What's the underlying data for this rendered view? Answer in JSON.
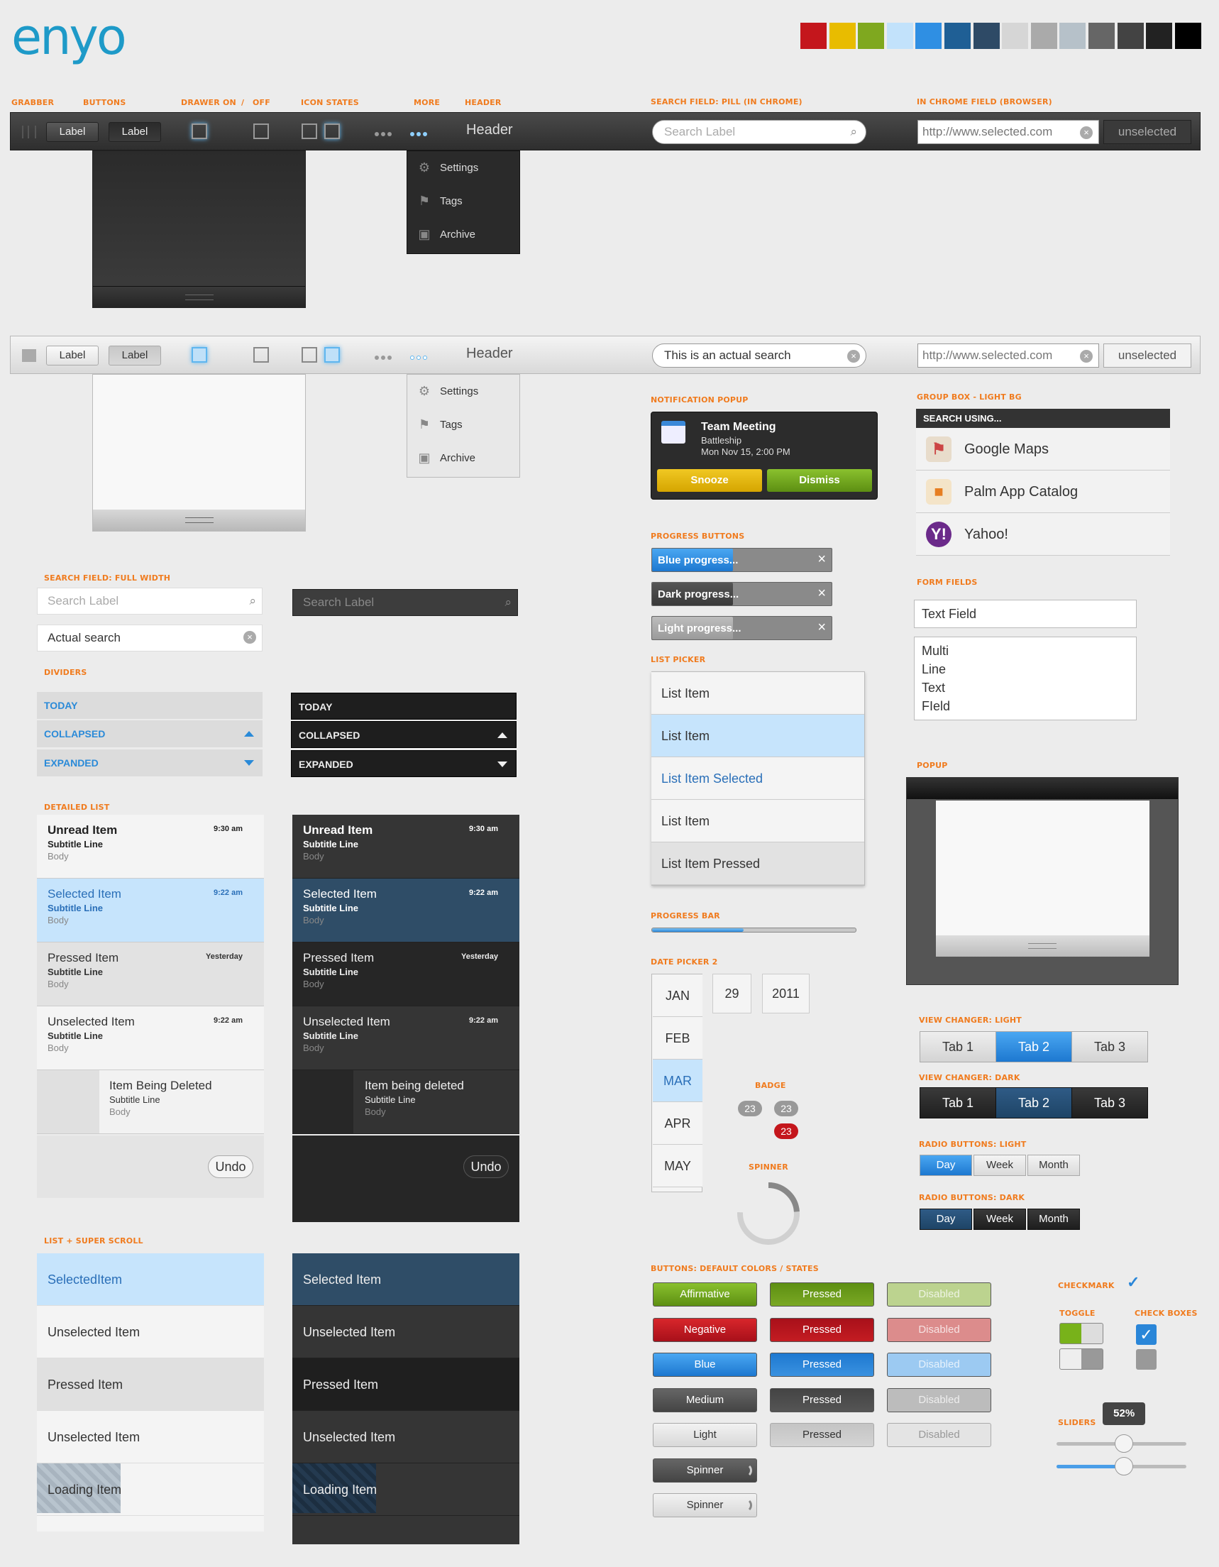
{
  "logo": "enyo",
  "swatches": [
    "#c4161c",
    "#e8bc00",
    "#7fa81f",
    "#c2e2fb",
    "#2f8fe3",
    "#1f5f95",
    "#2e4a66",
    "#d6d6d6",
    "#aaaaaa",
    "#b6c1c9",
    "#666666",
    "#434343",
    "#222222",
    "#000000"
  ],
  "labels": {
    "grabber": "GRABBER",
    "buttons": "BUTTONS",
    "drawer_on": "DRAWER ON",
    "slash": "/",
    "off": "OFF",
    "icon_states": "ICON STATES",
    "more": "MORE",
    "header": "HEADER",
    "search_pill": "SEARCH FIELD: PILL (IN CHROME)",
    "chrome_field": "IN CHROME FIELD (BROWSER)",
    "search_full": "SEARCH FIELD: FULL WIDTH",
    "dividers": "DIVIDERS",
    "detailed_list": "DETAILED LIST",
    "super_scroll": "LIST + SUPER SCROLL",
    "notification": "NOTIFICATION POPUP",
    "progress_buttons": "PROGRESS BUTTONS",
    "list_picker": "LIST PICKER",
    "progress_bar": "PROGRESS BAR",
    "date_picker": "DATE PICKER 2",
    "badge": "BADGE",
    "spinner": "SPINNER",
    "buttons_default": "BUTTONS: DEFAULT COLORS / STATES",
    "group_box": "GROUP BOX - LIGHT BG",
    "form_fields": "FORM FIELDS",
    "popup": "POPUP",
    "view_light": "VIEW CHANGER: LIGHT",
    "view_dark": "VIEW CHANGER: DARK",
    "radio_light": "RADIO BUTTONS: LIGHT",
    "radio_dark": "RADIO BUTTONS: DARK",
    "checkmark": "CHECKMARK",
    "toggle": "TOGGLE",
    "check_boxes": "CHECK BOXES",
    "sliders": "SLIDERS"
  },
  "toolbar": {
    "btn1": "Label",
    "btn2": "Label",
    "header": "Header",
    "search_placeholder": "Search Label",
    "search_value": "This is an actual search",
    "url": "http://www.selected.com",
    "unselected": "unselected"
  },
  "menu": [
    "Settings",
    "Tags",
    "Archive"
  ],
  "search_full": {
    "placeholder": "Search Label",
    "value": "Actual search"
  },
  "dividers": [
    "TODAY",
    "COLLAPSED",
    "EXPANDED"
  ],
  "detailed": [
    {
      "title": "Unread Item",
      "subtitle": "Subtitle Line",
      "body": "Body",
      "time": "9:30 am"
    },
    {
      "title": "Selected Item",
      "subtitle": "Subtitle Line",
      "body": "Body",
      "time": "9:22 am"
    },
    {
      "title": "Pressed Item",
      "subtitle": "Subtitle Line",
      "body": "Body",
      "time": "Yesterday"
    },
    {
      "title": "Unselected Item",
      "subtitle": "Subtitle Line",
      "body": "Body",
      "time": "9:22 am"
    }
  ],
  "deleting": {
    "light_title": "Item Being Deleted",
    "dark_title": "Item being deleted",
    "subtitle": "Subtitle Line",
    "body": "Body",
    "undo": "Undo"
  },
  "super_light": [
    "SelectedItem",
    "Unselected Item",
    "Pressed Item",
    "Unselected Item",
    "Loading Item"
  ],
  "super_dark": [
    "Selected Item",
    "Unselected Item",
    "Pressed Item",
    "Unselected Item",
    "Loading Item"
  ],
  "notification": {
    "title": "Team Meeting",
    "location": "Battleship",
    "time": "Mon Nov 15, 2:00 PM",
    "snooze": "Snooze",
    "dismiss": "Dismiss"
  },
  "progress_buttons": [
    {
      "label": "Blue progress...",
      "progress": 0.45
    },
    {
      "label": "Dark progress...",
      "progress": 0.45
    },
    {
      "label": "Light progress...",
      "progress": 0.45
    }
  ],
  "list_picker": [
    "List Item",
    "List Item",
    "List Item Selected",
    "List Item",
    "List Item Pressed"
  ],
  "progress_bar": 0.45,
  "date": {
    "months": [
      "JAN",
      "FEB",
      "MAR",
      "APR",
      "MAY"
    ],
    "day": "29",
    "year": "2011"
  },
  "badges": [
    "23",
    "23",
    "23"
  ],
  "buttons": [
    [
      "Affirmative",
      "Pressed",
      "Disabled"
    ],
    [
      "Negative",
      "Pressed",
      "Disabled"
    ],
    [
      "Blue",
      "Pressed",
      "Disabled"
    ],
    [
      "Medium",
      "Pressed",
      "Disabled"
    ],
    [
      "Light",
      "Pressed",
      "Disabled"
    ],
    [
      "Spinner"
    ],
    [
      "Spinner"
    ]
  ],
  "group_box": {
    "header": "SEARCH USING...",
    "items": [
      "Google Maps",
      "Palm App Catalog",
      "Yahoo!"
    ]
  },
  "form": {
    "text": "Text Field",
    "multi": [
      "Multi",
      "Line",
      "Text",
      "FIeld"
    ]
  },
  "tabs": [
    "Tab 1",
    "Tab 2",
    "Tab 3"
  ],
  "radios": [
    "Day",
    "Week",
    "Month"
  ],
  "slider": {
    "value": "52%",
    "level": 0.52
  }
}
